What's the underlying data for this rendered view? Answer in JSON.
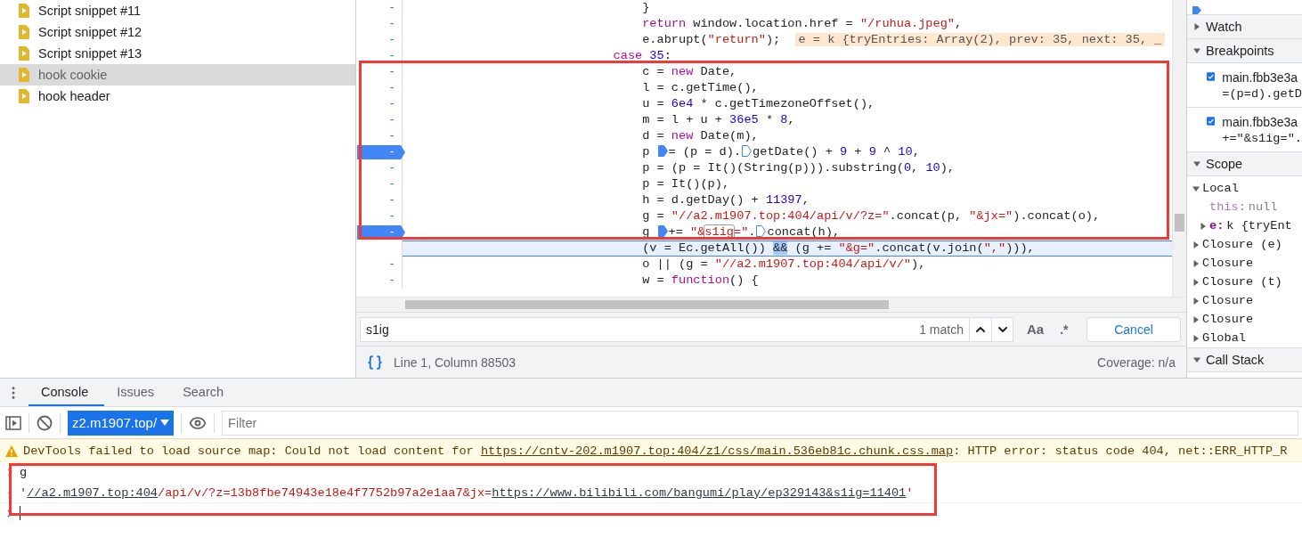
{
  "snippets": [
    {
      "label": "Script snippet #11",
      "selected": false
    },
    {
      "label": "Script snippet #12",
      "selected": false
    },
    {
      "label": "Script snippet #13",
      "selected": false
    },
    {
      "label": "hook cookie",
      "selected": true
    },
    {
      "label": "hook header",
      "selected": false
    }
  ],
  "editor": {
    "highlight_frame": true,
    "lines": [
      {
        "kind": "stmt",
        "gutter": "-",
        "breakpoint": false,
        "current": false,
        "tokens": [
          {
            "kind": "plain",
            "text": "}"
          }
        ]
      },
      {
        "kind": "stmt",
        "gutter": "-",
        "breakpoint": false,
        "current": false,
        "tokens": [
          {
            "kind": "keyword",
            "text": "return"
          },
          {
            "kind": "plain",
            "text": " window.location.href = "
          },
          {
            "kind": "string",
            "text": "\"/ruhua.jpeg\""
          },
          {
            "kind": "plain",
            "text": ","
          }
        ]
      },
      {
        "kind": "stmt",
        "gutter": "-",
        "breakpoint": false,
        "current": false,
        "tokens": [
          {
            "kind": "plain",
            "text": "e.abrupt("
          },
          {
            "kind": "string",
            "text": "\"return\""
          },
          {
            "kind": "plain",
            "text": ");"
          },
          {
            "kind": "value",
            "text": "e = k {tryEntries: Array(2), prev: 35, next: 35, _"
          }
        ]
      },
      {
        "kind": "label",
        "gutter": "-",
        "breakpoint": false,
        "current": false,
        "tokens": [
          {
            "kind": "keyword",
            "text": "case"
          },
          {
            "kind": "number",
            "text": " 35"
          },
          {
            "kind": "plain",
            "text": ":"
          }
        ]
      },
      {
        "kind": "stmt",
        "gutter": "-",
        "breakpoint": false,
        "current": false,
        "tokens": [
          {
            "kind": "plain",
            "text": "c = "
          },
          {
            "kind": "keyword",
            "text": "new"
          },
          {
            "kind": "plain",
            "text": " Date,"
          }
        ]
      },
      {
        "kind": "stmt",
        "gutter": "-",
        "breakpoint": false,
        "current": false,
        "tokens": [
          {
            "kind": "plain",
            "text": "l = c.getTime(),"
          }
        ]
      },
      {
        "kind": "stmt",
        "gutter": "-",
        "breakpoint": false,
        "current": false,
        "tokens": [
          {
            "kind": "plain",
            "text": "u = "
          },
          {
            "kind": "number",
            "text": "6e4"
          },
          {
            "kind": "plain",
            "text": " * c.getTimezoneOffset(),"
          }
        ]
      },
      {
        "kind": "stmt",
        "gutter": "-",
        "breakpoint": false,
        "current": false,
        "tokens": [
          {
            "kind": "plain",
            "text": "m = l + u + "
          },
          {
            "kind": "number",
            "text": "36e5"
          },
          {
            "kind": "plain",
            "text": " * "
          },
          {
            "kind": "number",
            "text": "8"
          },
          {
            "kind": "plain",
            "text": ","
          }
        ]
      },
      {
        "kind": "stmt",
        "gutter": "-",
        "breakpoint": false,
        "current": false,
        "tokens": [
          {
            "kind": "plain",
            "text": "d = "
          },
          {
            "kind": "keyword",
            "text": "new"
          },
          {
            "kind": "plain",
            "text": " Date(m),"
          }
        ]
      },
      {
        "kind": "stmt",
        "gutter": "-",
        "breakpoint": true,
        "current": false,
        "tokens": [
          {
            "kind": "plain",
            "text": "p "
          },
          {
            "kind": "marker",
            "active": true
          },
          {
            "kind": "plain",
            "text": "= (p = d)."
          },
          {
            "kind": "marker",
            "active": false
          },
          {
            "kind": "plain",
            "text": "getDate() + "
          },
          {
            "kind": "number",
            "text": "9"
          },
          {
            "kind": "plain",
            "text": " + "
          },
          {
            "kind": "number",
            "text": "9"
          },
          {
            "kind": "plain",
            "text": " ^ "
          },
          {
            "kind": "number",
            "text": "10"
          },
          {
            "kind": "plain",
            "text": ","
          }
        ]
      },
      {
        "kind": "stmt",
        "gutter": "-",
        "breakpoint": false,
        "current": false,
        "tokens": [
          {
            "kind": "plain",
            "text": "p = (p = It()(String(p))).substring("
          },
          {
            "kind": "number",
            "text": "0"
          },
          {
            "kind": "plain",
            "text": ", "
          },
          {
            "kind": "number",
            "text": "10"
          },
          {
            "kind": "plain",
            "text": "),"
          }
        ]
      },
      {
        "kind": "stmt",
        "gutter": "-",
        "breakpoint": false,
        "current": false,
        "tokens": [
          {
            "kind": "plain",
            "text": "p = It()(p),"
          }
        ]
      },
      {
        "kind": "stmt",
        "gutter": "-",
        "breakpoint": false,
        "current": false,
        "tokens": [
          {
            "kind": "plain",
            "text": "h = d.getDay() + "
          },
          {
            "kind": "number",
            "text": "11397"
          },
          {
            "kind": "plain",
            "text": ","
          }
        ]
      },
      {
        "kind": "stmt",
        "gutter": "-",
        "breakpoint": false,
        "current": false,
        "tokens": [
          {
            "kind": "plain",
            "text": "g = "
          },
          {
            "kind": "string",
            "text": "\"//a2.m1907.top:404/api/v/?z=\""
          },
          {
            "kind": "plain",
            "text": ".concat(p, "
          },
          {
            "kind": "string",
            "text": "\"&jx=\""
          },
          {
            "kind": "plain",
            "text": ").concat(o),"
          }
        ]
      },
      {
        "kind": "stmt",
        "gutter": "-",
        "breakpoint": true,
        "current": false,
        "tokens": [
          {
            "kind": "plain",
            "text": "g "
          },
          {
            "kind": "marker",
            "active": true
          },
          {
            "kind": "plain",
            "text": "+= "
          },
          {
            "kind": "string",
            "text": "\"&"
          },
          {
            "kind": "match",
            "text": "s1ig"
          },
          {
            "kind": "string",
            "text": "=\""
          },
          {
            "kind": "plain",
            "text": "."
          },
          {
            "kind": "marker",
            "active": false
          },
          {
            "kind": "plain",
            "text": "concat(h),"
          }
        ]
      },
      {
        "kind": "stmt",
        "breakpoint": false,
        "current": true,
        "tokens": [
          {
            "kind": "plain",
            "text": "(v = Ec.getAll()) "
          },
          {
            "kind": "bracket",
            "text": "&&"
          },
          {
            "kind": "plain",
            "text": " (g += "
          },
          {
            "kind": "string",
            "text": "\"&g=\""
          },
          {
            "kind": "plain",
            "text": ".concat(v.join("
          },
          {
            "kind": "string",
            "text": "\",\""
          },
          {
            "kind": "plain",
            "text": "))),"
          }
        ]
      },
      {
        "kind": "stmt",
        "gutter": "-",
        "breakpoint": false,
        "current": false,
        "tokens": [
          {
            "kind": "plain",
            "text": "o || (g = "
          },
          {
            "kind": "string",
            "text": "\"//a2.m1907.top:404/api/v/\""
          },
          {
            "kind": "plain",
            "text": "),"
          }
        ]
      },
      {
        "kind": "stmt",
        "gutter": "-",
        "breakpoint": false,
        "current": false,
        "tokens": [
          {
            "kind": "plain",
            "text": "w = "
          },
          {
            "kind": "keyword",
            "text": "function"
          },
          {
            "kind": "plain",
            "text": "() {"
          }
        ]
      }
    ]
  },
  "search": {
    "value": "s1ig",
    "matches": "1 match",
    "case_button": "Aa",
    "regex_button": ".*",
    "cancel": "Cancel"
  },
  "status_bar": {
    "position": "Line 1, Column 88503",
    "coverage": "Coverage: n/a"
  },
  "sidebar": {
    "sections": [
      {
        "title": "Watch",
        "expanded": false
      },
      {
        "title": "Breakpoints",
        "expanded": true,
        "breakpoints": [
          {
            "file": "main.fbb3e3a",
            "code": "=(p=d).getD",
            "checked": true
          },
          {
            "file": "main.fbb3e3a",
            "code": "+=\"&s1ig=\".",
            "checked": true
          }
        ]
      },
      {
        "title": "Scope",
        "expanded": true,
        "scopes": [
          {
            "name": "Local",
            "expanded": true,
            "children": [
              {
                "kind": "internal",
                "key": "this:",
                "value": "null"
              },
              {
                "kind": "own",
                "key": "e:",
                "value": "k {tryEnt",
                "expanded": false
              }
            ]
          },
          {
            "name": "Closure (e)",
            "expanded": false
          },
          {
            "name": "Closure",
            "expanded": false
          },
          {
            "name": "Closure (t)",
            "expanded": false
          },
          {
            "name": "Closure",
            "expanded": false
          },
          {
            "name": "Closure",
            "expanded": false
          },
          {
            "name": "Global",
            "expanded": false
          }
        ]
      },
      {
        "title": "Call Stack",
        "expanded": true
      }
    ]
  },
  "drawer": {
    "tabs": [
      {
        "label": "Console",
        "selected": true
      },
      {
        "label": "Issues",
        "selected": false
      },
      {
        "label": "Search",
        "selected": false
      }
    ],
    "context": "z2.m1907.top/",
    "filter_placeholder": "Filter",
    "highlight_frame": true,
    "messages": [
      {
        "kind": "warning",
        "parts": [
          {
            "kind": "text",
            "text": "DevTools failed to load source map: Could not load content for "
          },
          {
            "kind": "link",
            "text": "https://cntv-202.m1907.top:404/z1/css/main.536eb81c.chunk.css.map"
          },
          {
            "kind": "text",
            "text": ": HTTP error: status code 404, net::ERR_HTTP_R"
          }
        ]
      },
      {
        "kind": "input",
        "parts": [
          {
            "kind": "text",
            "text": "g"
          }
        ]
      },
      {
        "kind": "result",
        "parts": [
          {
            "kind": "string",
            "text": "'"
          },
          {
            "kind": "link",
            "text": "//a2.m1907.top:404"
          },
          {
            "kind": "string",
            "text": "/api/v/?z=13b8fbe74943e18e4f7752b97a2e1aa7&jx="
          },
          {
            "kind": "link",
            "text": "https://www.bilibili.com/bangumi/play/ep329143&s1ig=11401"
          },
          {
            "kind": "string",
            "text": "'"
          }
        ]
      }
    ]
  }
}
